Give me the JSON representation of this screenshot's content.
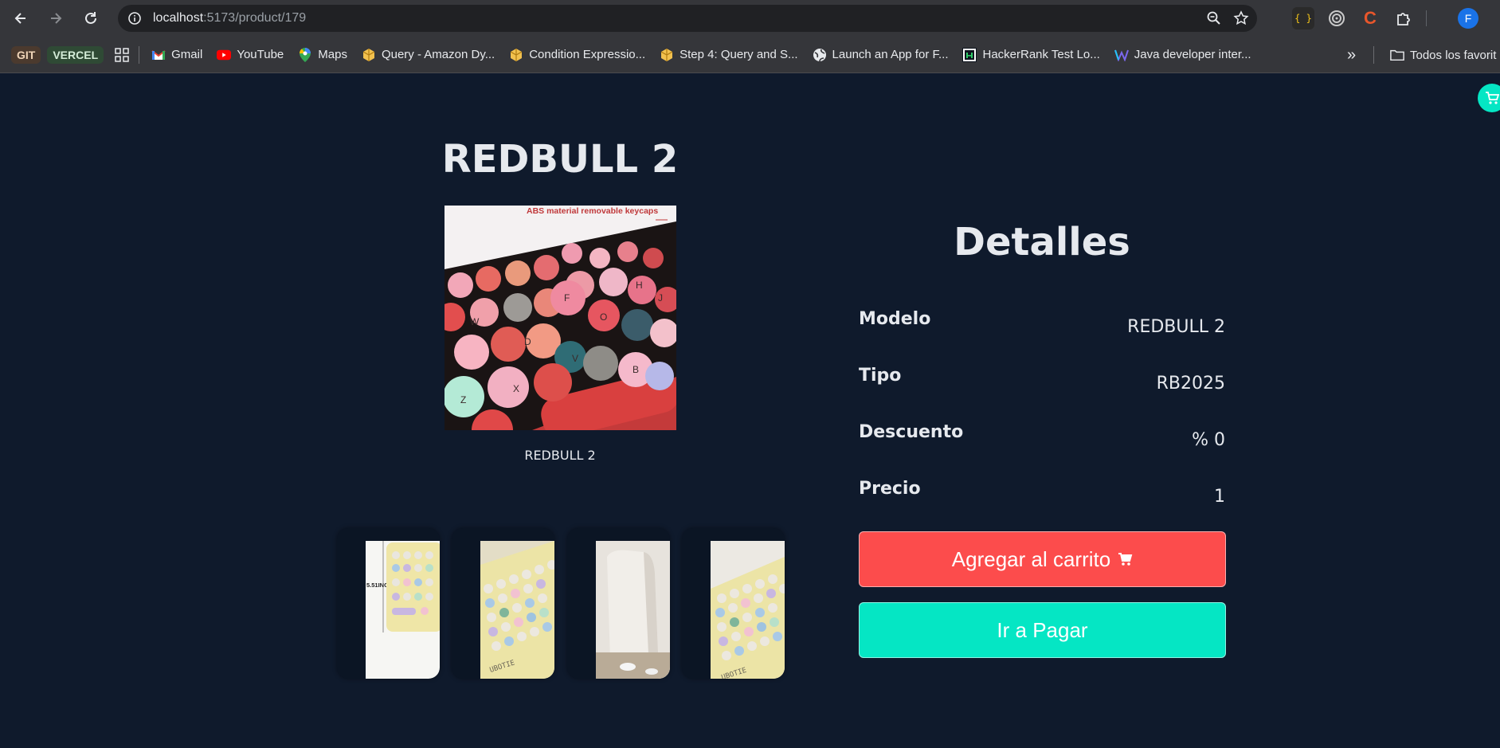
{
  "browser": {
    "url_host": "localhost",
    "url_path": ":5173/product/179",
    "profile_initial": "F",
    "bookmarks": {
      "chips": [
        "GIT",
        "VERCEL"
      ],
      "items": [
        {
          "label": "Gmail",
          "icon": "gmail-icon"
        },
        {
          "label": "YouTube",
          "icon": "youtube-icon"
        },
        {
          "label": "Maps",
          "icon": "maps-icon"
        },
        {
          "label": "Query - Amazon Dy...",
          "icon": "aws-icon"
        },
        {
          "label": "Condition Expressio...",
          "icon": "aws-icon"
        },
        {
          "label": "Step 4: Query and S...",
          "icon": "aws-icon"
        },
        {
          "label": "Launch an App for F...",
          "icon": "globe-icon"
        },
        {
          "label": "HackerRank Test Lo...",
          "icon": "hackerrank-icon"
        },
        {
          "label": "Java developer inter...",
          "icon": "w-icon"
        }
      ],
      "overflow": "»",
      "all_bookmarks": "Todos los favorit"
    }
  },
  "product": {
    "title": "REDBULL 2",
    "image_caption": "REDBULL 2",
    "image_overlay_text": "ABS material removable keycaps",
    "thumb_label": "5.51INCH",
    "thumb_brand": "UBOTIE"
  },
  "details": {
    "heading": "Detalles",
    "rows": [
      {
        "label": "Modelo",
        "value": "REDBULL 2"
      },
      {
        "label": "Tipo",
        "value": "RB2025"
      },
      {
        "label": "Descuento",
        "value": "% 0"
      },
      {
        "label": "Precio",
        "value": "1"
      }
    ]
  },
  "actions": {
    "add_to_cart": "Agregar al carrito",
    "go_to_pay": "Ir a Pagar"
  },
  "colors": {
    "background": "#0f1a2c",
    "add_button": "#fc4c4c",
    "pay_button": "#05e6c4"
  }
}
